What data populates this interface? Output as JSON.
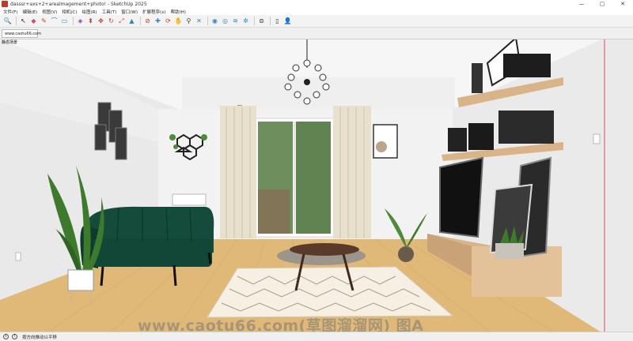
{
  "window": {
    "title": "dasssr+axs+2+arealmagement+photo! - SketchUp 2025",
    "minimize": "—",
    "maximize": "▢",
    "close": "✕"
  },
  "menu": [
    "文件(F)",
    "编辑(E)",
    "视图(V)",
    "相机(C)",
    "绘图(R)",
    "工具(T)",
    "窗口(W)",
    "扩展程序(x)",
    "帮助(H)"
  ],
  "toolbar": {
    "icons": [
      {
        "name": "search-icon",
        "glyph": "🔍",
        "color": "#555555"
      },
      {
        "name": "select-icon",
        "glyph": "↖",
        "color": "#222222"
      },
      {
        "name": "eraser-icon",
        "glyph": "◆",
        "color": "#d04a7a"
      },
      {
        "name": "pencil-icon",
        "glyph": "✎",
        "color": "#c0392b"
      },
      {
        "name": "arc-icon",
        "glyph": "⌒",
        "color": "#2e86c1"
      },
      {
        "name": "rectangle-icon",
        "glyph": "▭",
        "color": "#2e86c1"
      },
      {
        "name": "paint-bucket-icon",
        "glyph": "◈",
        "color": "#8e44ad"
      },
      {
        "name": "push-pull-icon",
        "glyph": "⬍",
        "color": "#c0392b"
      },
      {
        "name": "move-icon",
        "glyph": "✥",
        "color": "#c0392b"
      },
      {
        "name": "rotate-icon",
        "glyph": "↻",
        "color": "#c0392b"
      },
      {
        "name": "scale-icon",
        "glyph": "⤢",
        "color": "#c0392b"
      },
      {
        "name": "offset-icon",
        "glyph": "▲",
        "color": "#2e86c1"
      },
      {
        "name": "tape-measure-icon",
        "glyph": "⊘",
        "color": "#c0392b"
      },
      {
        "name": "text-icon",
        "glyph": "✚",
        "color": "#2e86c1"
      },
      {
        "name": "orbit-icon",
        "glyph": "⟳",
        "color": "#c0392b"
      },
      {
        "name": "pan-icon",
        "glyph": "✋",
        "color": "#c0392b"
      },
      {
        "name": "zoom-icon",
        "glyph": "⚲",
        "color": "#333333"
      },
      {
        "name": "zoom-extents-icon",
        "glyph": "✕",
        "color": "#2e86c1"
      },
      {
        "name": "warehouse-icon",
        "glyph": "◉",
        "color": "#2e86c1"
      },
      {
        "name": "extension-warehouse-icon",
        "glyph": "◎",
        "color": "#2e86c1"
      },
      {
        "name": "layout-icon",
        "glyph": "≋",
        "color": "#2e86c1"
      },
      {
        "name": "styles-icon",
        "glyph": "✲",
        "color": "#2e86c1"
      },
      {
        "name": "model-info-icon",
        "glyph": "⊜",
        "color": "#333333"
      },
      {
        "name": "new-file-icon",
        "glyph": "▯",
        "color": "#333333"
      },
      {
        "name": "user-icon",
        "glyph": "👤",
        "color": "#333333"
      }
    ]
  },
  "scene_tab": "www.caotu66.com",
  "scene_label": "静态场景",
  "watermark": "www.caotu66.com(草图溜溜网) 图A",
  "status": {
    "text": "按方向推动以平移"
  },
  "colors": {
    "sofa": "#154b3a",
    "floor": "#e0b877",
    "wall": "#f4f4f4",
    "curtain": "#e7e0cc",
    "shelf": "#d9b489",
    "accent_red_guide": "#e04a4a"
  }
}
